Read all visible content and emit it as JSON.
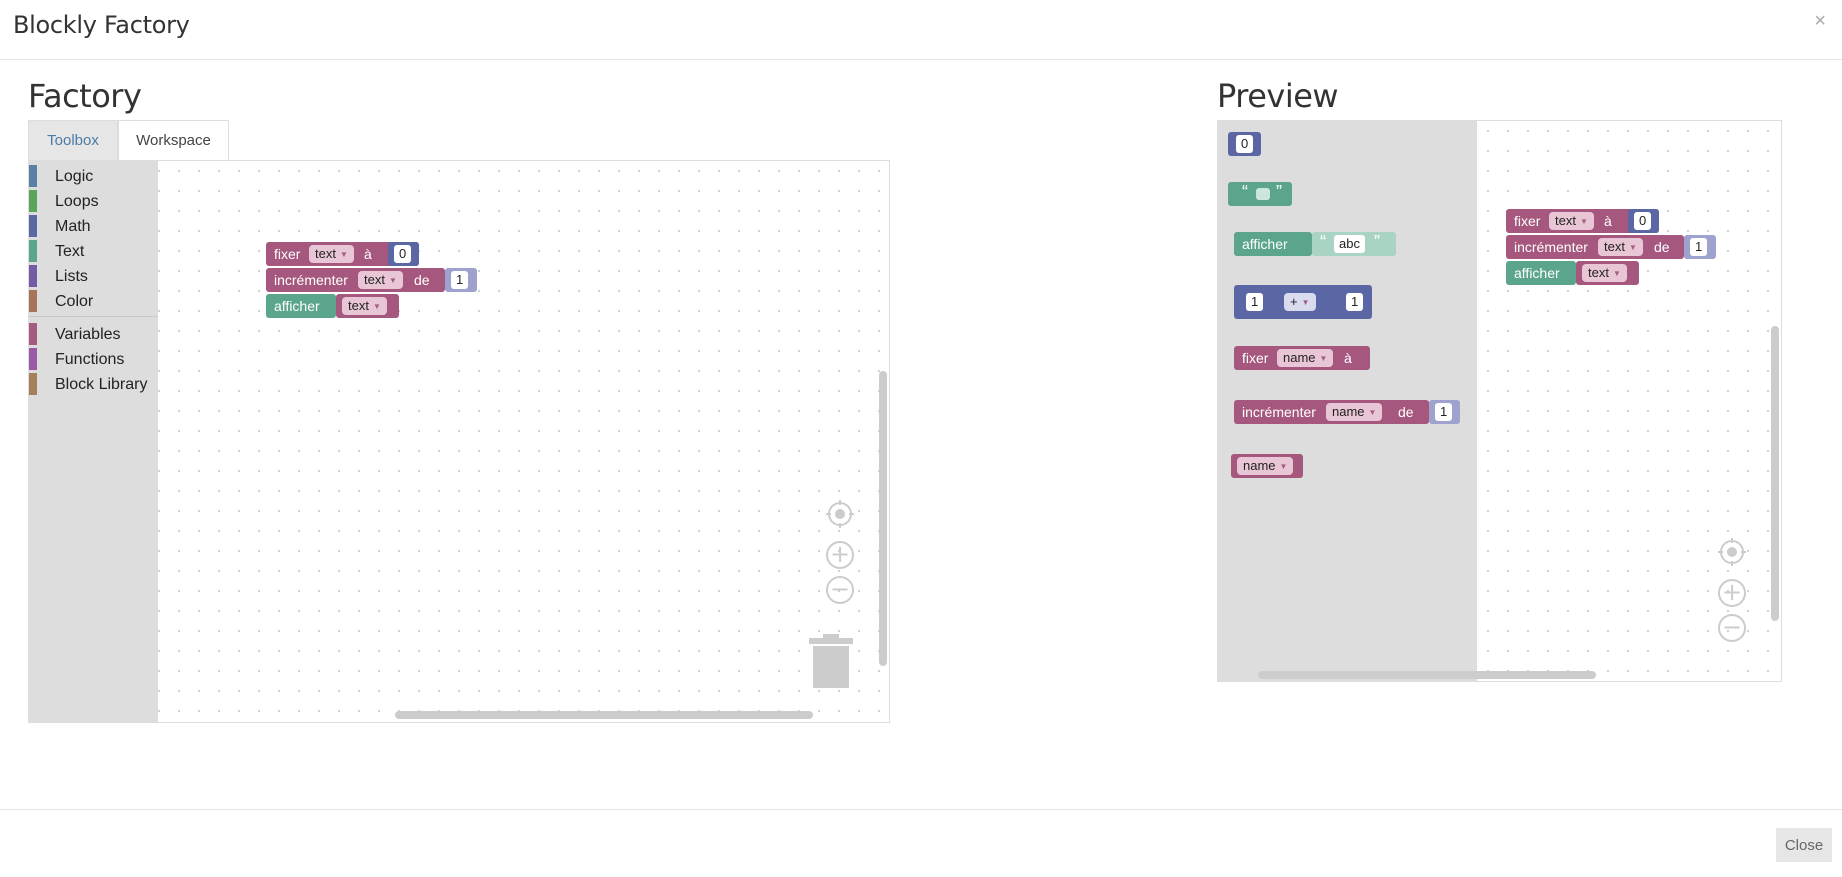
{
  "modal": {
    "title": "Blockly Factory",
    "close_icon": "×"
  },
  "factory": {
    "title": "Factory",
    "tabs": [
      {
        "label": "Toolbox",
        "active": true
      },
      {
        "label": "Workspace",
        "active": false
      }
    ],
    "categories": [
      {
        "label": "Logic",
        "color": "#5b80a5"
      },
      {
        "label": "Loops",
        "color": "#5ba55b"
      },
      {
        "label": "Math",
        "color": "#5b67a5"
      },
      {
        "label": "Text",
        "color": "#5ba58c"
      },
      {
        "label": "Lists",
        "color": "#745ba5"
      },
      {
        "label": "Color",
        "color": "#a5745b"
      },
      {
        "label": "Variables",
        "color": "#a55b80"
      },
      {
        "label": "Functions",
        "color": "#995ba5"
      },
      {
        "label": "Block Library",
        "color": "#a5805b"
      }
    ],
    "blocks": {
      "set": {
        "label": "fixer",
        "var": "text",
        "to": "à",
        "value": "0"
      },
      "change": {
        "label": "incrémenter",
        "var": "text",
        "by": "de",
        "value": "1"
      },
      "print": {
        "label": "afficher",
        "var": "text"
      }
    }
  },
  "preview": {
    "title": "Preview",
    "flyout": {
      "number": "0",
      "text_quote_open": "“",
      "text_quote_close": "”",
      "print": {
        "label": "afficher",
        "quote_open": "“",
        "value": "abc",
        "quote_close": "”"
      },
      "arith": {
        "a": "1",
        "op": "+",
        "b": "1"
      },
      "set": {
        "label": "fixer",
        "var": "name",
        "to": "à"
      },
      "change": {
        "label": "incrémenter",
        "var": "name",
        "by": "de",
        "value": "1"
      },
      "get": {
        "var": "name"
      }
    },
    "blocks": {
      "set": {
        "label": "fixer",
        "var": "text",
        "to": "à",
        "value": "0"
      },
      "change": {
        "label": "incrémenter",
        "var": "text",
        "by": "de",
        "value": "1"
      },
      "print": {
        "label": "afficher",
        "var": "text"
      }
    }
  },
  "footer": {
    "close_label": "Close"
  }
}
